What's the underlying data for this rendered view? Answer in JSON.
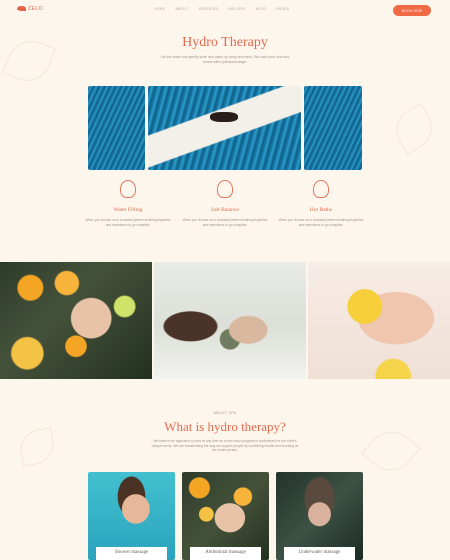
{
  "brand": {
    "name": "ZELO",
    "accent": "#e46a4f",
    "button": "#ef6a45",
    "background": "#fdf6ec"
  },
  "nav": {
    "items": [
      "HOME",
      "ABOUT",
      "SERVICES",
      "GALLERY",
      "BLOG",
      "PAGES"
    ],
    "book_label": "BOOK NOW"
  },
  "hero": {
    "title": "Hydro Therapy",
    "intro": "Let the water cool gently soak and warm up body and mind. We calm your skin and renew with a pleasant stage."
  },
  "features": [
    {
      "title": "Water Filling",
      "icon": "water-icon",
      "text": "When you choose us to a relaxed perfect soothing expertise and experience to go complete."
    },
    {
      "title": "Salt Balance",
      "icon": "lotus-icon",
      "text": "When you choose us to a relaxed perfect soothing expertise and experience to go complete."
    },
    {
      "title": "Hot Baths",
      "icon": "flame-icon",
      "text": "When you choose us to a relaxed perfect soothing expertise and experience to go complete."
    }
  ],
  "about": {
    "eyebrow": "ABOUT SPA",
    "title": "What is hydro therapy?",
    "text": "We believe the approach to work at any time as a new touch program is customized for the client's unique needs. We are transforming the way we support people by combining results and focusing on the whole person."
  },
  "services": [
    {
      "label": "Shower massage"
    },
    {
      "label": "Abdominal massage"
    },
    {
      "label": "Underwater massage"
    }
  ]
}
